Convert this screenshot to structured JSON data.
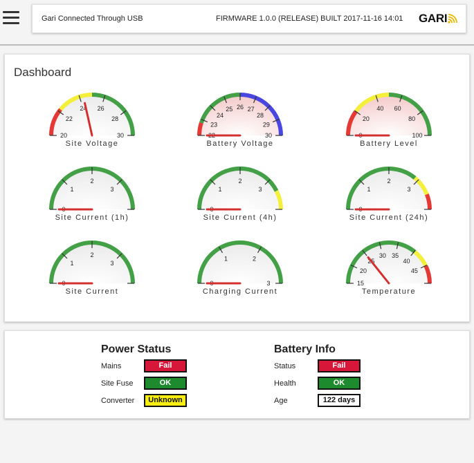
{
  "header": {
    "connection": "Gari Connected Through USB",
    "firmware": "FIRMWARE 1.0.0 (RELEASE) BUILT 2017-11-16 14:01",
    "logo": "GARI"
  },
  "dashboard": {
    "title": "Dashboard",
    "gauges": [
      {
        "label": "Site Voltage",
        "min": 20,
        "max": 30,
        "value": 24.3,
        "ticks": [
          "20",
          "22",
          "24",
          "26",
          "28",
          "30"
        ],
        "bands": [
          {
            "from": 0,
            "to": 0.22,
            "color": "#e53935"
          },
          {
            "from": 0.22,
            "to": 0.5,
            "color": "#f4ef3a"
          },
          {
            "from": 0.5,
            "to": 1,
            "color": "#43a047"
          }
        ],
        "face": "#e9e9e9"
      },
      {
        "label": "Battery Voltage",
        "min": 22,
        "max": 30,
        "value": 22,
        "ticks": [
          "22",
          "23",
          "24",
          "25",
          "26",
          "27",
          "28",
          "29",
          "30"
        ],
        "bands": [
          {
            "from": 0,
            "to": 0.1,
            "color": "#e53935"
          },
          {
            "from": 0.1,
            "to": 0.5,
            "color": "#43a047"
          },
          {
            "from": 0.5,
            "to": 1,
            "color": "#4a46e0"
          }
        ],
        "face": "#f3c6c6"
      },
      {
        "label": "Battery Level",
        "min": 0,
        "max": 100,
        "value": 0,
        "ticks": [
          "0",
          "20",
          "40",
          "60",
          "80",
          "100"
        ],
        "bands": [
          {
            "from": 0,
            "to": 0.2,
            "color": "#e53935"
          },
          {
            "from": 0.2,
            "to": 0.5,
            "color": "#f4ef3a"
          },
          {
            "from": 0.5,
            "to": 1,
            "color": "#43a047"
          }
        ],
        "face": "#f3c6c6"
      },
      {
        "label": "Site Current (1h)",
        "min": 0,
        "max": 4,
        "value": 0,
        "ticks": [
          "0",
          "1",
          "2",
          "3",
          ""
        ],
        "bands": [
          {
            "from": 0,
            "to": 1,
            "color": "#43a047"
          }
        ],
        "face": "#e9e9e9"
      },
      {
        "label": "Site Current (4h)",
        "min": 0,
        "max": 4,
        "value": 0,
        "ticks": [
          "0",
          "1",
          "2",
          "3",
          ""
        ],
        "bands": [
          {
            "from": 0,
            "to": 0.85,
            "color": "#43a047"
          },
          {
            "from": 0.85,
            "to": 1,
            "color": "#f4ef3a"
          }
        ],
        "face": "#e9e9e9"
      },
      {
        "label": "Site Current (24h)",
        "min": 0,
        "max": 4,
        "value": 0,
        "ticks": [
          "0",
          "1",
          "2",
          "3",
          ""
        ],
        "bands": [
          {
            "from": 0,
            "to": 0.72,
            "color": "#43a047"
          },
          {
            "from": 0.72,
            "to": 0.88,
            "color": "#f4ef3a"
          },
          {
            "from": 0.88,
            "to": 1,
            "color": "#e53935"
          }
        ],
        "face": "#e9e9e9"
      },
      {
        "label": "Site Current",
        "min": 0,
        "max": 4,
        "value": 0,
        "ticks": [
          "0",
          "1",
          "2",
          "3",
          ""
        ],
        "bands": [
          {
            "from": 0,
            "to": 1,
            "color": "#43a047"
          }
        ],
        "face": "#e9e9e9"
      },
      {
        "label": "Charging Current",
        "min": 0,
        "max": 3,
        "value": 0,
        "ticks": [
          "0",
          "1",
          "2",
          "3"
        ],
        "bands": [
          {
            "from": 0,
            "to": 1,
            "color": "#43a047"
          }
        ],
        "face": "#e9e9e9"
      },
      {
        "label": "Temperature",
        "min": 15,
        "max": 50,
        "value": 25,
        "ticks": [
          "15",
          "20",
          "25",
          "30",
          "35",
          "40",
          "45",
          ""
        ],
        "bands": [
          {
            "from": 0,
            "to": 0.72,
            "color": "#43a047"
          },
          {
            "from": 0.72,
            "to": 0.86,
            "color": "#f4ef3a"
          },
          {
            "from": 0.86,
            "to": 1,
            "color": "#e53935"
          }
        ],
        "face": "#e9e9e9"
      }
    ]
  },
  "power": {
    "title": "Power Status",
    "rows": [
      {
        "label": "Mains",
        "value": "Fail",
        "state": "fail"
      },
      {
        "label": "Site Fuse",
        "value": "OK",
        "state": "ok"
      },
      {
        "label": "Converter",
        "value": "Unknown",
        "state": "unknown"
      }
    ]
  },
  "battery": {
    "title": "Battery Info",
    "rows": [
      {
        "label": "Status",
        "value": "Fail",
        "state": "fail"
      },
      {
        "label": "Health",
        "value": "OK",
        "state": "ok"
      },
      {
        "label": "Age",
        "value": "122 days",
        "state": "plain"
      }
    ]
  },
  "colors": {
    "fail": "#d6173a",
    "ok": "#1e8a2e",
    "unknown": "#f7ee10",
    "needle": "#d32f2f"
  }
}
